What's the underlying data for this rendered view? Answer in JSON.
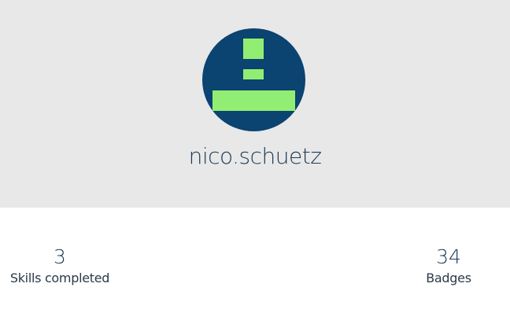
{
  "profile": {
    "username": "nico.schuetz",
    "avatar_icon": "identicon-avatar",
    "avatar_bg_color": "#0b4371",
    "avatar_fg_color": "#92ee72"
  },
  "stats": [
    {
      "value": "3",
      "label": "Skills completed"
    },
    {
      "value": "34",
      "label": "Badges"
    }
  ],
  "colors": {
    "header_bg": "#e8e8e8",
    "text": "#1e3a55"
  }
}
